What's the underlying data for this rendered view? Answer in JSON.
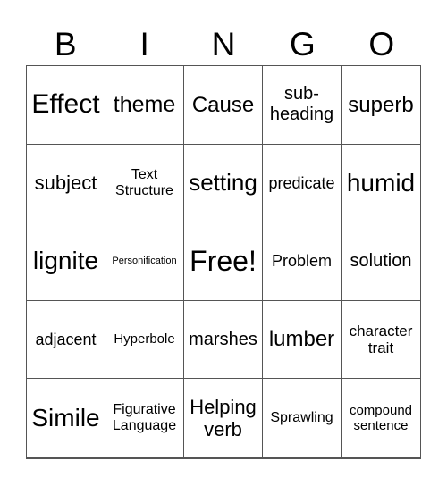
{
  "header": {
    "letters": [
      "B",
      "I",
      "N",
      "G",
      "O"
    ]
  },
  "grid": {
    "rows": [
      [
        "Effect",
        "theme",
        "Cause",
        "sub-\nheading",
        "superb"
      ],
      [
        "subject",
        "Text\nStructure",
        "setting",
        "predicate",
        "humid"
      ],
      [
        "lignite",
        "Personification",
        "Free!",
        "Problem",
        "solution"
      ],
      [
        "adjacent",
        "Hyperbole",
        "marshes",
        "lumber",
        "character\ntrait"
      ],
      [
        "Simile",
        "Figurative\nLanguage",
        "Helping\nverb",
        "Sprawling",
        "compound\nsentence"
      ]
    ],
    "free_space": {
      "row": 2,
      "col": 2,
      "label": "Free!"
    }
  }
}
